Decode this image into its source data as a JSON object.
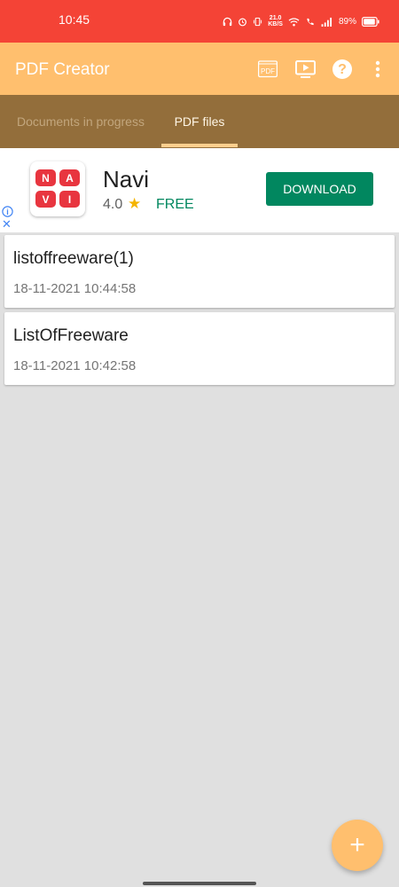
{
  "status_bar": {
    "time": "10:45",
    "network_speed_value": "21.0",
    "network_speed_unit": "KB/S",
    "battery_percent": "89%"
  },
  "app_bar": {
    "title": "PDF Creator",
    "icons": [
      "pdf-file-icon",
      "video-tutorial-icon",
      "help-icon",
      "more-options-icon"
    ],
    "pdf_icon_text": "PDF",
    "help_icon_text": "?"
  },
  "tabs": [
    {
      "label": "Documents in progress",
      "active": false
    },
    {
      "label": "PDF files",
      "active": true
    }
  ],
  "ad": {
    "app_name": "Navi",
    "rating": "4.0",
    "star": "★",
    "price": "FREE",
    "cta": "DOWNLOAD",
    "logo_letters": [
      "N",
      "A",
      "V",
      "I"
    ],
    "close_symbol": "✕",
    "info_symbol": "i"
  },
  "files": [
    {
      "name": "listoffreeware(1)",
      "date": "18-11-2021 10:44:58"
    },
    {
      "name": "ListOfFreeware",
      "date": "18-11-2021 10:42:58"
    }
  ],
  "fab": {
    "label": "+"
  },
  "colors": {
    "status_bar": "#f44336",
    "app_bar": "#ffbf6e",
    "tab_bar": "#936e3b",
    "ad_button": "#01875f",
    "background": "#e0e0e0"
  }
}
